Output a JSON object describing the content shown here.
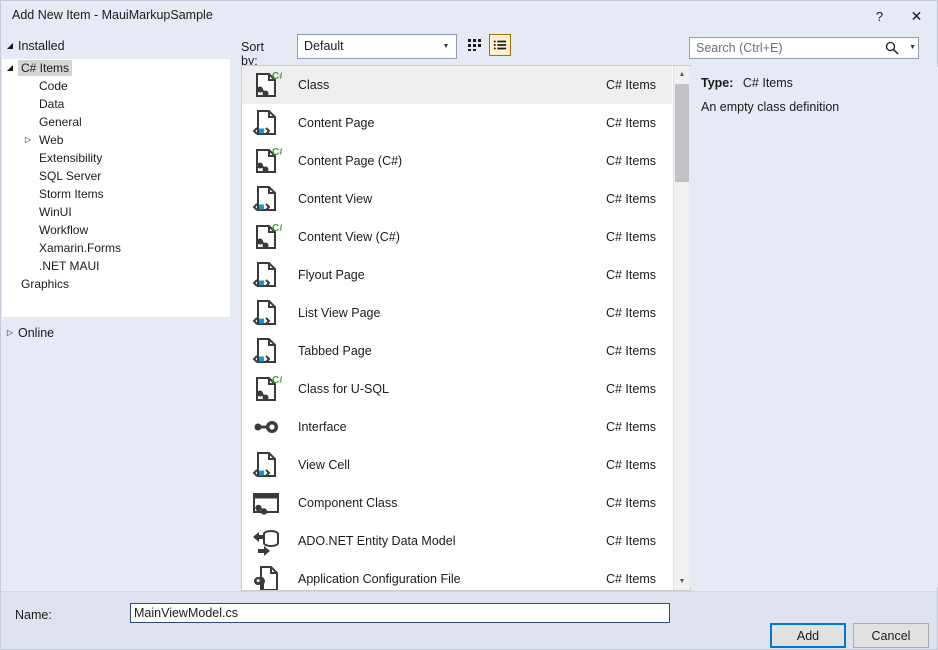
{
  "window": {
    "title": "Add New Item - MauiMarkupSample",
    "help_label": "?",
    "close_label": "✕"
  },
  "sidebar": {
    "header": {
      "label": "Installed",
      "expander": "◢"
    },
    "tree": [
      {
        "label": "C# Items",
        "indent": 0,
        "expander": "◢",
        "selected": true
      },
      {
        "label": "Code",
        "indent": 1,
        "expander": "",
        "selected": false
      },
      {
        "label": "Data",
        "indent": 1,
        "expander": "",
        "selected": false
      },
      {
        "label": "General",
        "indent": 1,
        "expander": "",
        "selected": false
      },
      {
        "label": "Web",
        "indent": 1,
        "expander": "▷",
        "selected": false
      },
      {
        "label": "Extensibility",
        "indent": 1,
        "expander": "",
        "selected": false
      },
      {
        "label": "SQL Server",
        "indent": 1,
        "expander": "",
        "selected": false
      },
      {
        "label": "Storm Items",
        "indent": 1,
        "expander": "",
        "selected": false
      },
      {
        "label": "WinUI",
        "indent": 1,
        "expander": "",
        "selected": false
      },
      {
        "label": "Workflow",
        "indent": 1,
        "expander": "",
        "selected": false
      },
      {
        "label": "Xamarin.Forms",
        "indent": 1,
        "expander": "",
        "selected": false
      },
      {
        "label": ".NET MAUI",
        "indent": 1,
        "expander": "",
        "selected": false
      },
      {
        "label": "Graphics",
        "indent": 0,
        "expander": "",
        "selected": false
      }
    ],
    "online": {
      "label": "Online",
      "expander": "▷"
    }
  },
  "toolbar": {
    "sort_label": "Sort by:",
    "sort_value": "Default",
    "sort_arrow": "▼",
    "tiles_view_name": "tiles-view",
    "list_view_name": "list-view"
  },
  "search": {
    "placeholder": "Search (Ctrl+E)",
    "dropdown_arrow": "▼"
  },
  "list": {
    "category_all": "C# Items",
    "items": [
      {
        "name": "Class",
        "category": "C# Items",
        "icon": "csharp-file-icon",
        "selected": true
      },
      {
        "name": "Content Page",
        "category": "C# Items",
        "icon": "xaml-file-icon",
        "selected": false
      },
      {
        "name": "Content Page (C#)",
        "category": "C# Items",
        "icon": "csharp-file-icon",
        "selected": false
      },
      {
        "name": "Content View",
        "category": "C# Items",
        "icon": "xaml-file-icon",
        "selected": false
      },
      {
        "name": "Content View (C#)",
        "category": "C# Items",
        "icon": "csharp-file-icon",
        "selected": false
      },
      {
        "name": "Flyout Page",
        "category": "C# Items",
        "icon": "xaml-file-icon",
        "selected": false
      },
      {
        "name": "List View Page",
        "category": "C# Items",
        "icon": "xaml-file-icon",
        "selected": false
      },
      {
        "name": "Tabbed Page",
        "category": "C# Items",
        "icon": "xaml-file-icon",
        "selected": false
      },
      {
        "name": "Class for U-SQL",
        "category": "C# Items",
        "icon": "csharp-file-icon",
        "selected": false
      },
      {
        "name": "Interface",
        "category": "C# Items",
        "icon": "interface-icon",
        "selected": false
      },
      {
        "name": "View Cell",
        "category": "C# Items",
        "icon": "xaml-file-icon",
        "selected": false
      },
      {
        "name": "Component Class",
        "category": "C# Items",
        "icon": "component-icon",
        "selected": false
      },
      {
        "name": "ADO.NET Entity Data Model",
        "category": "C# Items",
        "icon": "entity-model-icon",
        "selected": false
      },
      {
        "name": "Application Configuration File",
        "category": "C# Items",
        "icon": "config-file-icon",
        "selected": false
      }
    ],
    "scroll_up_arrow": "▲",
    "scroll_down_arrow": "▼"
  },
  "details": {
    "type_label": "Type:",
    "type_value": "C# Items",
    "description": "An empty class definition"
  },
  "footer": {
    "name_label": "Name:",
    "name_value": "MainViewModel.cs",
    "add_label": "Add",
    "cancel_label": "Cancel"
  },
  "colors": {
    "dialog_bg": "#e6eaf4",
    "footer_bg": "#dfe3ef",
    "accent": "#0078d7",
    "list_selection": "#eeeeee",
    "toggle_active_bg": "#fdf0cd",
    "toggle_active_border": "#a1720a",
    "xaml_blue": "#0f9bd7",
    "csharp_green": "#3f9c35"
  }
}
